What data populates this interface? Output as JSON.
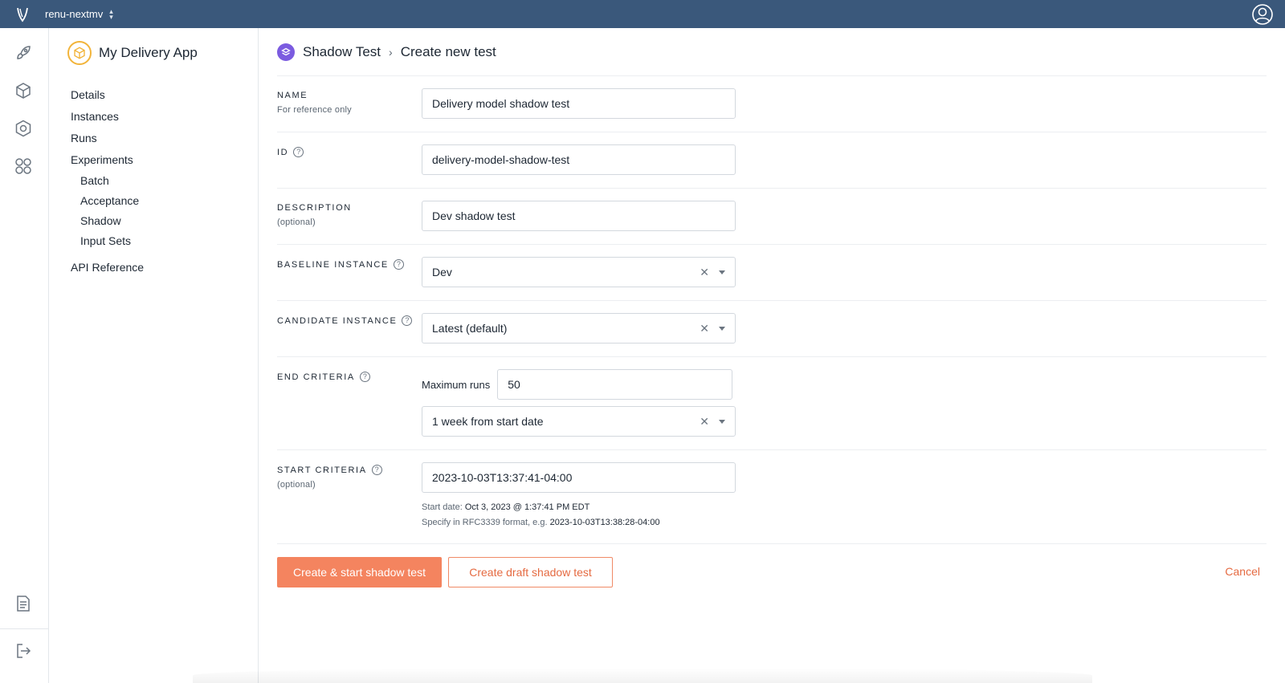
{
  "topbar": {
    "org_name": "renu-nextmv",
    "logo_icon": "nextmv-logo-icon",
    "account_icon": "user-circle-icon"
  },
  "rail": {
    "icons": [
      "rocket-icon",
      "cube-icon",
      "hexagon-icon",
      "grid-circles-icon",
      "document-icon",
      "logout-icon"
    ]
  },
  "app_nav": {
    "title": "My Delivery App",
    "items": [
      {
        "label": "Details"
      },
      {
        "label": "Instances"
      },
      {
        "label": "Runs"
      },
      {
        "label": "Experiments"
      }
    ],
    "sub_items": [
      {
        "label": "Batch"
      },
      {
        "label": "Acceptance"
      },
      {
        "label": "Shadow"
      },
      {
        "label": "Input Sets"
      }
    ],
    "api_reference": "API Reference"
  },
  "breadcrumb": {
    "section": "Shadow Test",
    "separator": "›",
    "current": "Create new test"
  },
  "form": {
    "name": {
      "label": "NAME",
      "hint": "For reference only",
      "value": "Delivery model shadow test"
    },
    "id": {
      "label": "ID",
      "value": "delivery-model-shadow-test"
    },
    "description": {
      "label": "DESCRIPTION",
      "hint": "(optional)",
      "value": "Dev shadow test"
    },
    "baseline": {
      "label": "BASELINE INSTANCE",
      "value": "Dev"
    },
    "candidate": {
      "label": "CANDIDATE INSTANCE",
      "value": "Latest (default)"
    },
    "end_criteria": {
      "label": "END CRITERIA",
      "max_runs_label": "Maximum runs",
      "max_runs_value": "50",
      "duration_value": "1 week from start date"
    },
    "start_criteria": {
      "label": "START CRITERIA",
      "hint": "(optional)",
      "value": "2023-10-03T13:37:41-04:00",
      "start_date_prefix": "Start date:",
      "start_date_value": "Oct 3, 2023 @ 1:37:41 PM EDT",
      "format_prefix": "Specify in RFC3339 format, e.g.",
      "format_example": "2023-10-03T13:38:28-04:00"
    }
  },
  "actions": {
    "primary": "Create & start shadow test",
    "secondary": "Create draft shadow test",
    "cancel": "Cancel"
  },
  "colors": {
    "topbar": "#3a587b",
    "primary_button": "#f4845f",
    "accent": "#e56a41",
    "shadow_badge": "#7b5be0",
    "app_badge": "#f2b43a"
  }
}
